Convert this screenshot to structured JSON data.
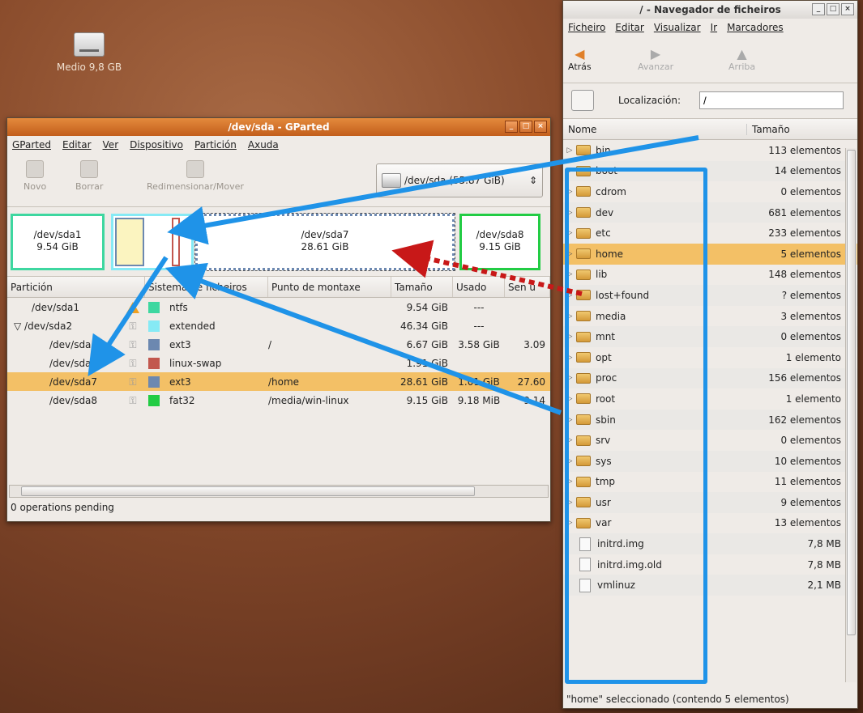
{
  "desktop": {
    "icon_label": "Medio 9,8 GB"
  },
  "gparted": {
    "title": "/dev/sda - GParted",
    "menu": [
      "GParted",
      "Editar",
      "Ver",
      "Dispositivo",
      "Partición",
      "Axuda"
    ],
    "toolbar": {
      "new": "Novo",
      "delete": "Borrar",
      "resize": "Redimensionar/Mover",
      "device": "/dev/sda  (55.87 GiB)"
    },
    "map": {
      "sda1": {
        "name": "/dev/sda1",
        "size": "9.54 GiB"
      },
      "sda7": {
        "name": "/dev/sda7",
        "size": "28.61 GiB"
      },
      "sda8": {
        "name": "/dev/sda8",
        "size": "9.15 GiB"
      }
    },
    "columns": [
      "Partición",
      "Sistema de ficheiros",
      "Punto de montaxe",
      "Tamaño",
      "Usado",
      "Sen u"
    ],
    "rows": [
      {
        "part": "/dev/sda1",
        "fs": "ntfs",
        "mount": "",
        "size": "9.54 GiB",
        "used": "---",
        "free": "",
        "color": "#3ed7a0"
      },
      {
        "part": "/dev/sda2",
        "fs": "extended",
        "mount": "",
        "size": "46.34 GiB",
        "used": "---",
        "free": "",
        "color": "#86eaf5"
      },
      {
        "part": "/dev/sda5",
        "fs": "ext3",
        "mount": "/",
        "size": "6.67 GiB",
        "used": "3.58 GiB",
        "free": "3.09",
        "color": "#6c88b0"
      },
      {
        "part": "/dev/sda6",
        "fs": "linux-swap",
        "mount": "",
        "size": "1.91 GiB",
        "used": "",
        "free": "",
        "color": "#c2574e"
      },
      {
        "part": "/dev/sda7",
        "fs": "ext3",
        "mount": "/home",
        "size": "28.61 GiB",
        "used": "1.01 GiB",
        "free": "27.60",
        "color": "#6c88b0"
      },
      {
        "part": "/dev/sda8",
        "fs": "fat32",
        "mount": "/media/win-linux",
        "size": "9.15 GiB",
        "used": "9.18 MiB",
        "free": "9.14",
        "color": "#22cc44"
      }
    ],
    "status": "0 operations pending"
  },
  "nautilus": {
    "title": "/ - Navegador de ficheiros",
    "menu": [
      "Ficheiro",
      "Editar",
      "Visualizar",
      "Ir",
      "Marcadores"
    ],
    "toolbar": {
      "back": "Atrás",
      "forward": "Avanzar",
      "up": "Arriba"
    },
    "location_label": "Localización:",
    "location_value": "/",
    "columns": {
      "name": "Nome",
      "size": "Tamaño"
    },
    "files": [
      {
        "name": "bin",
        "size": "113 elementos"
      },
      {
        "name": "boot",
        "size": "14 elementos"
      },
      {
        "name": "cdrom",
        "size": "0 elementos"
      },
      {
        "name": "dev",
        "size": "681 elementos"
      },
      {
        "name": "etc",
        "size": "233 elementos"
      },
      {
        "name": "home",
        "size": "5 elementos"
      },
      {
        "name": "lib",
        "size": "148 elementos"
      },
      {
        "name": "lost+found",
        "size": "? elementos"
      },
      {
        "name": "media",
        "size": "3 elementos"
      },
      {
        "name": "mnt",
        "size": "0 elementos"
      },
      {
        "name": "opt",
        "size": "1 elemento"
      },
      {
        "name": "proc",
        "size": "156 elementos"
      },
      {
        "name": "root",
        "size": "1 elemento"
      },
      {
        "name": "sbin",
        "size": "162 elementos"
      },
      {
        "name": "srv",
        "size": "0 elementos"
      },
      {
        "name": "sys",
        "size": "10 elementos"
      },
      {
        "name": "tmp",
        "size": "11 elementos"
      },
      {
        "name": "usr",
        "size": "9 elementos"
      },
      {
        "name": "var",
        "size": "13 elementos"
      },
      {
        "name": "initrd.img",
        "size": "7,8 MB"
      },
      {
        "name": "initrd.img.old",
        "size": "7,8 MB"
      },
      {
        "name": "vmlinuz",
        "size": "2,1 MB"
      }
    ],
    "status": "\"home\" seleccionado (contendo 5 elementos)"
  }
}
